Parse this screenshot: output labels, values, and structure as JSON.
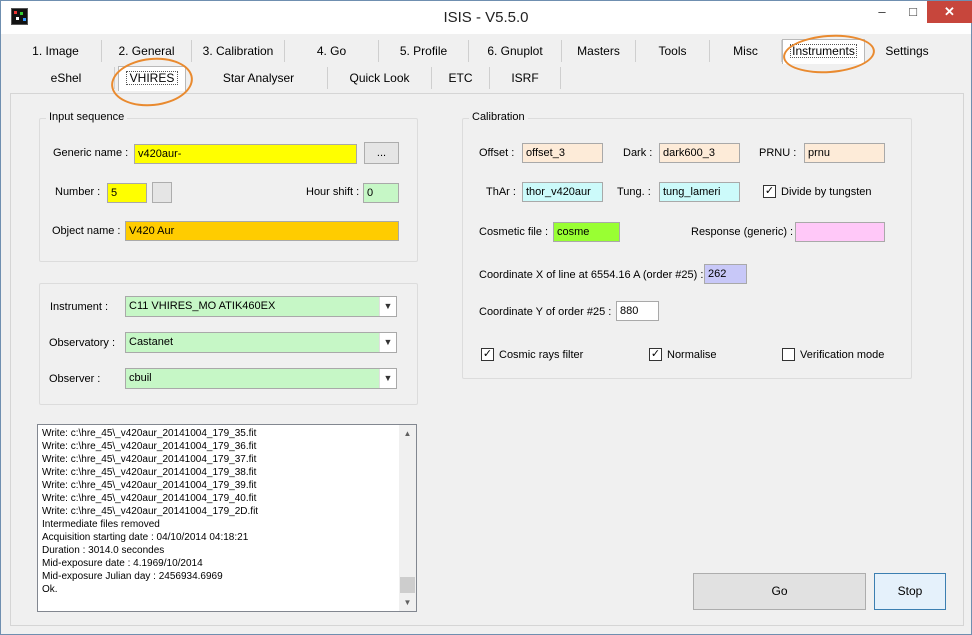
{
  "window": {
    "title": "ISIS - V5.5.0",
    "minimize": "–",
    "maximize": "□",
    "close": "✕"
  },
  "tabs_row1": [
    "1. Image",
    "2. General",
    "3. Calibration",
    "4. Go",
    "5. Profile",
    "6. Gnuplot",
    "Masters",
    "Tools",
    "Misc",
    "Instruments",
    "Settings"
  ],
  "tabs_row2": [
    "eShel",
    "VHIRES",
    "Star Analyser",
    "Quick Look",
    "ETC",
    "ISRF"
  ],
  "input_sequence": {
    "title": "Input sequence",
    "generic_name_label": "Generic name :",
    "generic_name": "v420aur-",
    "browse_label": "...",
    "number_label": "Number :",
    "number": "5",
    "hour_shift_label": "Hour shift :",
    "hour_shift": "0",
    "object_name_label": "Object name :",
    "object_name": "V420 Aur"
  },
  "setup": {
    "instrument_label": "Instrument :",
    "instrument": "C11 VHIRES_MO ATIK460EX",
    "observatory_label": "Observatory :",
    "observatory": "Castanet",
    "observer_label": "Observer :",
    "observer": "cbuil"
  },
  "calibration": {
    "title": "Calibration",
    "offset_label": "Offset :",
    "offset": "offset_3",
    "dark_label": "Dark :",
    "dark": "dark600_3",
    "prnu_label": "PRNU :",
    "prnu": "prnu",
    "thar_label": "ThAr :",
    "thar": "thor_v420aur",
    "tung_label": "Tung. :",
    "tung": "tung_lameri",
    "divide_label": "Divide by tungsten",
    "cosmetic_label": "Cosmetic file :",
    "cosmetic": "cosme",
    "response_label": "Response (generic) :",
    "response": "",
    "coord_x_label": "Coordinate X of line at 6554.16 A (order #25) :",
    "coord_x": "262",
    "coord_y_label": "Coordinate Y of order #25 :",
    "coord_y": "880",
    "cosmic_label": "Cosmic rays filter",
    "normalise_label": "Normalise",
    "verification_label": "Verification mode"
  },
  "checks": {
    "divide": "✓",
    "cosmic": "✓",
    "normalise": "✓",
    "verification": ""
  },
  "log": [
    "Write: c:\\hre_45\\_v420aur_20141004_179_35.fit",
    "Write: c:\\hre_45\\_v420aur_20141004_179_36.fit",
    "Write: c:\\hre_45\\_v420aur_20141004_179_37.fit",
    "Write: c:\\hre_45\\_v420aur_20141004_179_38.fit",
    "Write: c:\\hre_45\\_v420aur_20141004_179_39.fit",
    "Write: c:\\hre_45\\_v420aur_20141004_179_40.fit",
    "Write: c:\\hre_45\\_v420aur_20141004_179_2D.fit",
    "Intermediate files removed",
    "Acquisition starting date : 04/10/2014 04:18:21",
    "Duration : 3014.0 secondes",
    "Mid-exposure date : 4.1969/10/2014",
    "Mid-exposure Julian day : 2456934.6969",
    "Ok."
  ],
  "buttons": {
    "go": "Go",
    "stop": "Stop"
  },
  "colors": {
    "yellow": "#ffff00",
    "orange": "#ffcc00",
    "green": "#c6f7c6",
    "peach": "#fdebd8",
    "cyan": "#ccfafa",
    "lime": "#99ff33",
    "pink": "#ffc8f8",
    "lavender": "#c8c8f8"
  }
}
